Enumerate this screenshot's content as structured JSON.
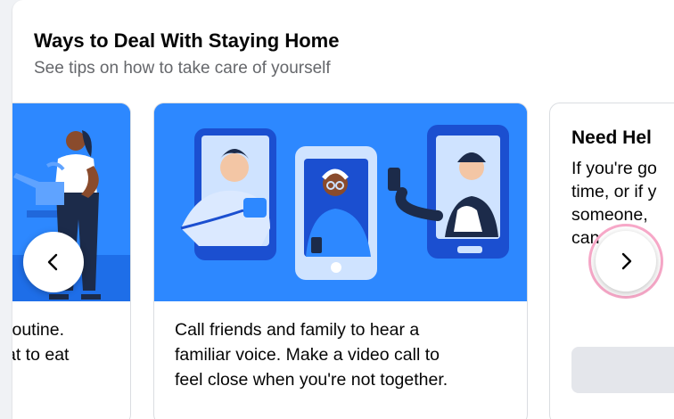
{
  "section": {
    "title": "Ways to Deal With Staying Home",
    "subtitle": "See tips on how to take care of yourself"
  },
  "cards": [
    {
      "text_lines": [
        "routine.",
        "at to eat"
      ]
    },
    {
      "text_lines": [
        "Call friends and family to hear a",
        "familiar voice. Make a video call to",
        "feel close when you're not together."
      ]
    },
    {
      "title": "Need Hel",
      "text_lines": [
        "If you're go",
        "time, or if y",
        "someone, ",
        "can"
      ]
    }
  ],
  "navigation": {
    "prev_icon": "chevron-left-icon",
    "next_icon": "chevron-right-icon"
  },
  "colors": {
    "accent_blue": "#2d88ff",
    "dark_blue": "#1b4fd0",
    "highlight_ring": "#f7a8c8"
  }
}
